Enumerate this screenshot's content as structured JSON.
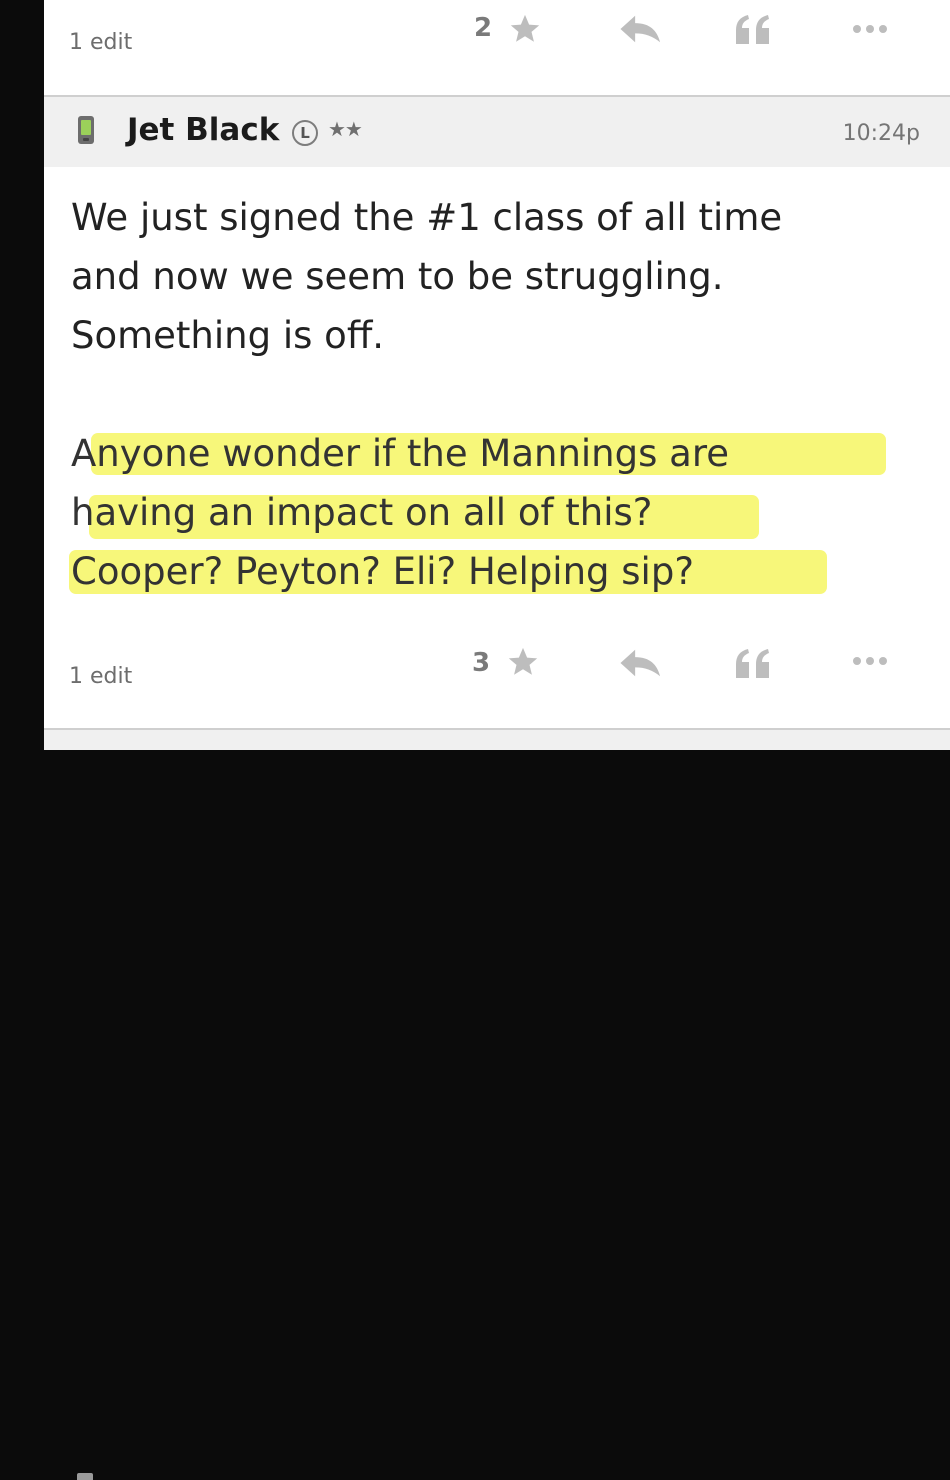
{
  "previous_post": {
    "edit_label": "1 edit",
    "score": "2",
    "icons": [
      "star-icon",
      "reply-icon",
      "quote-icon",
      "more-icon"
    ]
  },
  "post": {
    "author": "Jet Black",
    "badge": "L",
    "rank_stars": "★★",
    "time": "10:24p",
    "paragraph1": [
      "We just signed the #1 class of all time",
      "and now we seem to be struggling.",
      "Something is off."
    ],
    "paragraph2": [
      "Anyone wonder if the Mannings are",
      "having an impact on all of this?",
      "Cooper? Peyton? Eli? Helping sip?"
    ],
    "edit_label": "1 edit",
    "score": "3",
    "icons": [
      "phone-icon",
      "star-icon",
      "reply-icon",
      "quote-icon",
      "more-icon"
    ]
  },
  "colors": {
    "highlight": "#f4f446",
    "header_bg": "#f0f0f0",
    "separator": "#cfcfcf",
    "icon_gray": "#bdbdbd"
  }
}
